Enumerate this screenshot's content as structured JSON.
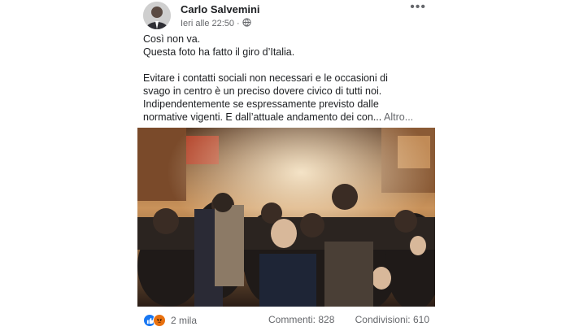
{
  "post": {
    "author": "Carlo Salvemini",
    "timestamp": "Ieri alle 22:50",
    "separator": "·",
    "privacy_icon": "globe-icon",
    "more_label": "•••",
    "lines": [
      "Così non va.",
      "Questa foto ha fatto il giro d’Italia.",
      "",
      "Evitare i contatti sociali non necessari e le occasioni di",
      "svago in centro è un preciso dovere civico di tutti noi.",
      "Indipendentemente se espressamente previsto dalle",
      "normative vigenti. E dall’attuale andamento dei con..."
    ],
    "see_more": "Altro...",
    "photo_icon": "crowd-photo"
  },
  "footer": {
    "reactions_count": "2 mila",
    "reaction_icons": [
      "like-icon",
      "angry-icon"
    ],
    "comments": "Commenti: 828",
    "shares": "Condivisioni: 610"
  },
  "colors": {
    "text": "#1c1e21",
    "secondary": "#65676b",
    "like": "#1877f2",
    "angry": "#e9710f"
  }
}
